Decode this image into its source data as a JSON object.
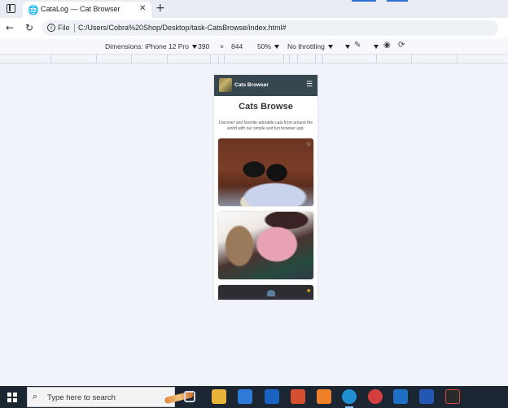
{
  "browser": {
    "tab_title": "CataLog — Cat Browser",
    "tab_close": "✕",
    "new_tab": "+",
    "back": "←",
    "reload": "↻",
    "info": "i",
    "address_scheme": "File",
    "address_url": "C:/Users/Cobra%20Shop/Desktop/task-CatsBrowse/index.html#"
  },
  "devtools": {
    "dimensions_label": "Dimensions: iPhone 12 Pro",
    "width": "390",
    "times": "×",
    "height": "844",
    "zoom": "50%",
    "throttling": "No throttling",
    "icons": [
      "more-options-icon",
      "pen-icon",
      "settings-icon",
      "eye-icon",
      "rotate-icon"
    ]
  },
  "phone_page": {
    "nav_brand": "Cats Browser",
    "menu_glyph": "☰",
    "title": "Cats Browse",
    "subtitle": "Discover and favorite adorable cats from around the world with our simple and fun browser app.",
    "cards": [
      {
        "alt": "two black cats on a leather couch",
        "favorite": false,
        "star": "☆"
      },
      {
        "alt": "tabby cat held in a pink shirt",
        "favorite": false,
        "star": ""
      },
      {
        "alt": "cat photo",
        "favorite": true,
        "star": "★"
      }
    ]
  },
  "taskbar": {
    "search_placeholder": "Type here to search",
    "search_glyph": "⌕",
    "apps": [
      "task-view",
      "file-explorer",
      "microsoft-store",
      "outlook",
      "office-app",
      "xampp",
      "edge",
      "chrome",
      "vscode",
      "word",
      "media-app"
    ]
  }
}
